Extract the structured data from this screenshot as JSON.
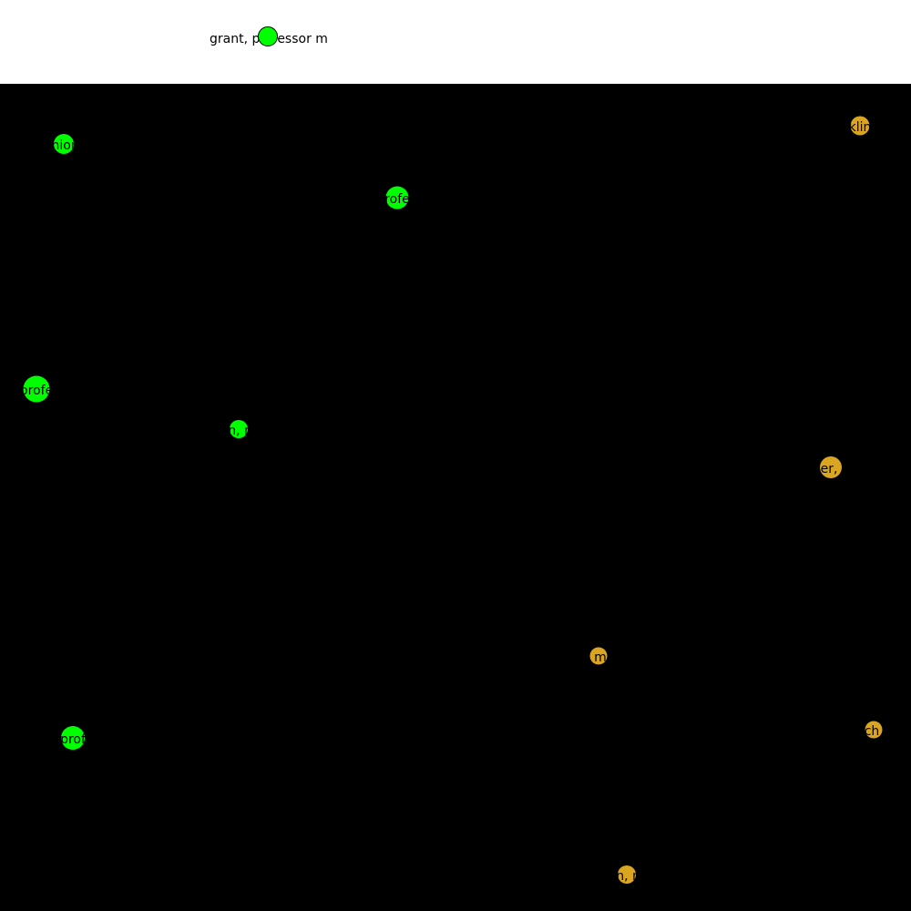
{
  "legend": {
    "label": "grant, professor m",
    "color": "#00ff00"
  },
  "canvas": {
    "background": "#000000"
  },
  "groups": {
    "green": "#00ff00",
    "gold": "#daa520"
  },
  "nodes": [
    {
      "label": "nior",
      "group": "green"
    },
    {
      "label": "rofe",
      "group": "green"
    },
    {
      "label": "profe",
      "group": "green"
    },
    {
      "label": "n, r",
      "group": "green"
    },
    {
      "label": "prof",
      "group": "green"
    },
    {
      "label": "klin",
      "group": "gold"
    },
    {
      "label": "er,",
      "group": "gold"
    },
    {
      "label": "m",
      "group": "gold"
    },
    {
      "label": "ch",
      "group": "gold"
    },
    {
      "label": "n, r",
      "group": "gold"
    }
  ]
}
